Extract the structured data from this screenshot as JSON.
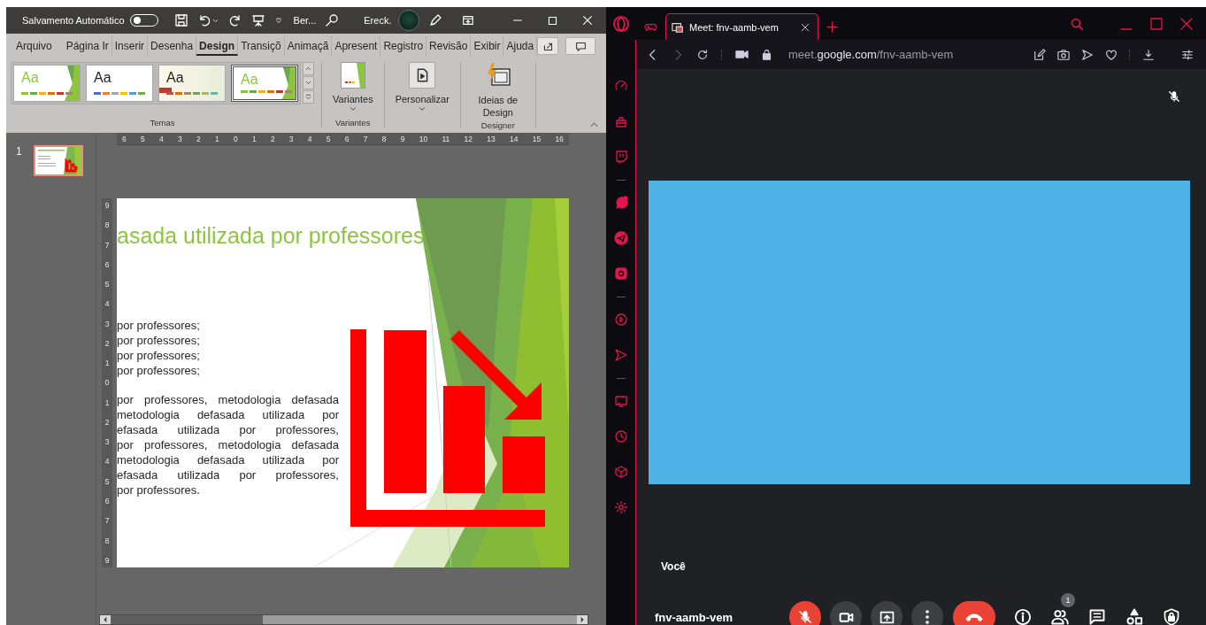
{
  "powerpoint": {
    "title_bar": {
      "autosave_label": "Salvamento Automático",
      "autosave_on": false,
      "file_name": "Ber...",
      "user_name": "Ereck."
    },
    "ribbon_tabs": [
      {
        "label": "Arquivo",
        "selected": false
      },
      {
        "label": "Página Ir",
        "selected": false
      },
      {
        "label": "Inserir",
        "selected": false
      },
      {
        "label": "Desenha",
        "selected": false
      },
      {
        "label": "Design",
        "selected": true
      },
      {
        "label": "Transiçõ",
        "selected": false
      },
      {
        "label": "Animaçã",
        "selected": false
      },
      {
        "label": "Apresent",
        "selected": false
      },
      {
        "label": "Registro",
        "selected": false
      },
      {
        "label": "Revisão",
        "selected": false
      },
      {
        "label": "Exibir",
        "selected": false
      },
      {
        "label": "Ajuda",
        "selected": false
      }
    ],
    "themes": {
      "label": "Temas",
      "items": [
        {
          "kind": "facet",
          "sample": "Aa",
          "selected": false
        },
        {
          "kind": "plain",
          "sample": "Aa",
          "selected": false
        },
        {
          "kind": "cream",
          "sample": "Aa",
          "selected": false
        },
        {
          "kind": "facet",
          "sample": "Aa",
          "selected": true
        }
      ]
    },
    "ribbon_groups": [
      {
        "kind": "variants",
        "button": "Variantes",
        "label": "Variantes"
      },
      {
        "kind": "customize",
        "button": "Personalizar"
      },
      {
        "kind": "designer",
        "button": "Ideias de Design",
        "label": "Designer"
      }
    ],
    "ruler": {
      "horizontal": [
        "6",
        "5",
        "4",
        "3",
        "2",
        "1",
        "0",
        "1",
        "2",
        "3",
        "4",
        "5",
        "6",
        "7",
        "8",
        "9",
        "10",
        "11",
        "12",
        "13",
        "14",
        "15",
        "16"
      ],
      "vertical": [
        "9",
        "8",
        "7",
        "6",
        "5",
        "4",
        "3",
        "2",
        "1",
        "0",
        "1",
        "2",
        "3",
        "4",
        "5",
        "6",
        "7",
        "8",
        "9"
      ]
    },
    "slides": [
      {
        "number": "1",
        "selected": true
      }
    ],
    "slide": {
      "title": "asada utilizada por professores",
      "bullets": [
        "por professores;",
        "por professores;",
        "por professores;",
        "por professores;"
      ],
      "paragraph_lines": [
        "por professores, metodologia defasada",
        "metodologia defasada utilizada por",
        "efasada utilizada por professores,",
        "por professores, metodologia defasada",
        "metodologia defasada utilizada por",
        "efasada utilizada por professores,",
        "por professores."
      ]
    }
  },
  "browser": {
    "tab": {
      "title": "Meet: fnv-aamb-vem",
      "selected": true
    },
    "url": {
      "host_prefix": "meet.",
      "domain": "google.com",
      "path": "/fnv-aamb-vem"
    },
    "meet": {
      "tile_name": "Você",
      "meeting_code": "fnv-aamb-vem",
      "participant_count": "1",
      "mic_on": false
    }
  }
}
